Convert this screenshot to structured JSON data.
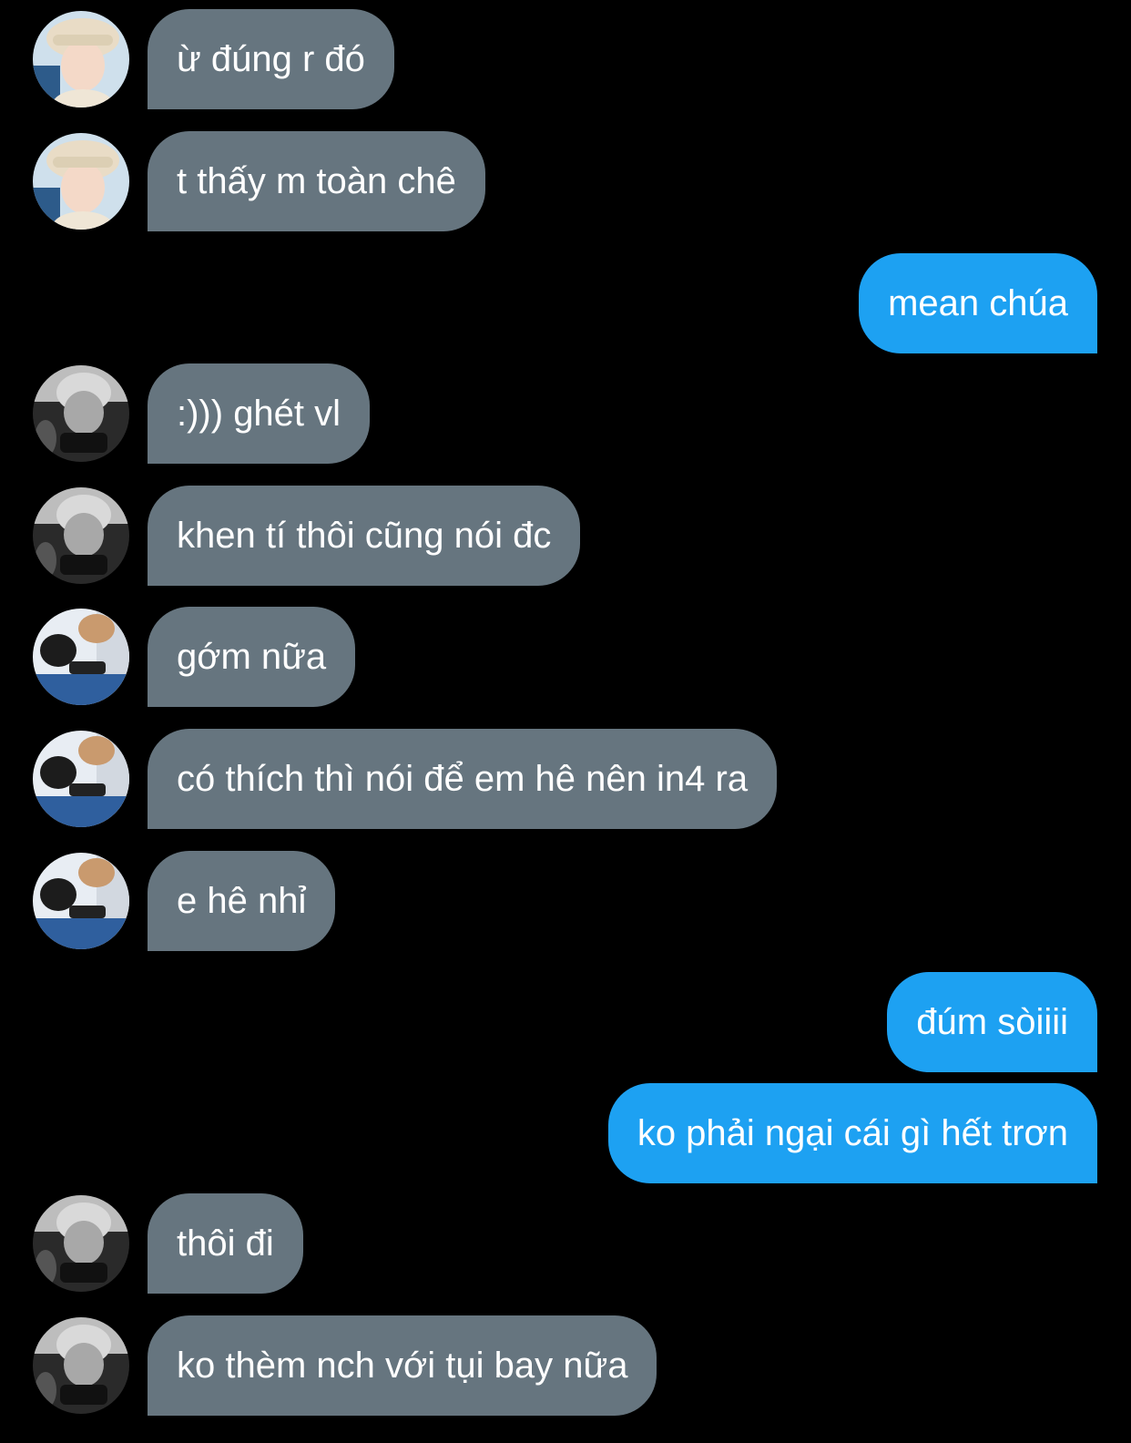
{
  "colors": {
    "background": "#000000",
    "incoming_bubble": "#66757f",
    "outgoing_bubble": "#1da1f2",
    "text": "#ffffff"
  },
  "messages": [
    {
      "side": "in",
      "avatar": "avatar-hat",
      "text": "ừ đúng r đó"
    },
    {
      "side": "in",
      "avatar": "avatar-hat",
      "text": "t thấy m toàn chê"
    },
    {
      "side": "out",
      "text": "mean chúa"
    },
    {
      "side": "in",
      "avatar": "avatar-bw",
      "text": ":))) ghét vl"
    },
    {
      "side": "in",
      "avatar": "avatar-bw",
      "text": "khen tí thôi cũng nói đc"
    },
    {
      "side": "in",
      "avatar": "avatar-duo",
      "text": "gớm nữa"
    },
    {
      "side": "in",
      "avatar": "avatar-duo",
      "text": "có thích thì nói để em hê nên in4 ra"
    },
    {
      "side": "in",
      "avatar": "avatar-duo",
      "text": "e hê nhỉ"
    },
    {
      "side": "out",
      "text": "đúm sòiiii"
    },
    {
      "side": "out",
      "text": "ko phải ngại cái gì hết trơn"
    },
    {
      "side": "in",
      "avatar": "avatar-bw",
      "text": "thôi đi"
    },
    {
      "side": "in",
      "avatar": "avatar-bw",
      "text": "ko thèm nch với tụi bay nữa"
    }
  ]
}
